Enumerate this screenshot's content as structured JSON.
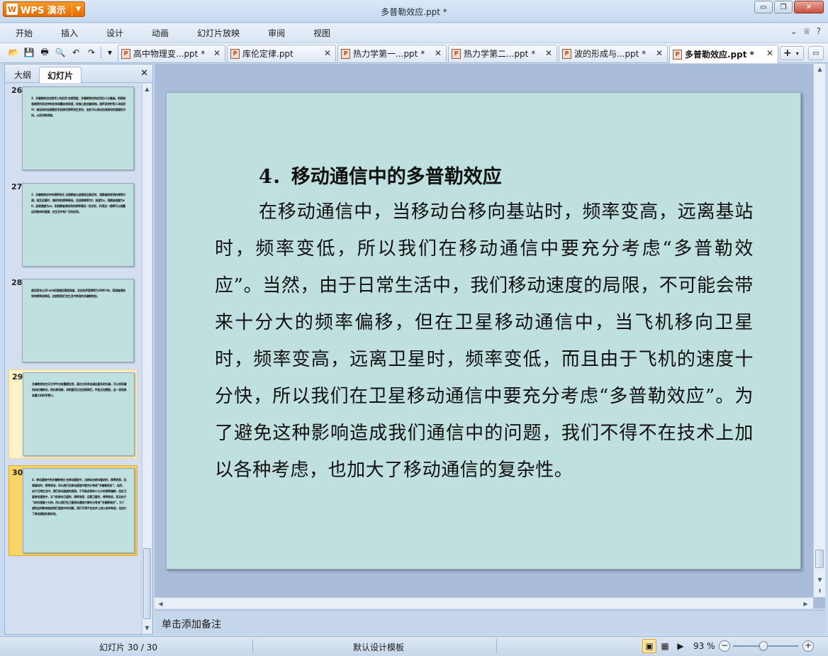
{
  "app": {
    "name": "WPS 演示",
    "logo_glyph": "W",
    "window_title": "多普勒效应.ppt *"
  },
  "window_controls": {
    "minimize": "▭",
    "restore": "❐",
    "close": "✕"
  },
  "menu": [
    "开始",
    "插入",
    "设计",
    "动画",
    "幻灯片放映",
    "审阅",
    "视图"
  ],
  "menu_right": {
    "chevron": "⌄",
    "skin": "♕",
    "help": "?"
  },
  "quick_access": {
    "open": "📂",
    "save": "💾",
    "print": "🖶",
    "preview": "🔍",
    "undo": "↶",
    "redo": "↷",
    "more": "▾"
  },
  "doc_tabs": [
    {
      "label": "高中物理变...ppt *"
    },
    {
      "label": "库伦定律.ppt"
    },
    {
      "label": "热力学第一...ppt *"
    },
    {
      "label": "热力学第二...ppt *"
    },
    {
      "label": "波的形成与...ppt *"
    },
    {
      "label": "多普勒效应.ppt *",
      "active": true
    }
  ],
  "tab_close_glyph": "✕",
  "tab_add": {
    "plus": "+",
    "dropdown": "▾"
  },
  "tab_menu_glyph": "▭",
  "ppt_icon_glyph": "P",
  "left_panel": {
    "tab_outline": "大纲",
    "tab_slides": "幻灯片",
    "close": "✕"
  },
  "thumbnails": [
    {
      "number": "26",
      "text": "3．多普勒效应在医学上的应用 在医院里，多普勒效应的应用也十分普遍。彩超检查就是利用这种效应来测量血液流速，检查心脏血管疾病。超声波发射到人体组织中，被运动的血细胞反射回来后频率发生变化，由此可以测出血液流动的速度和方向，从而诊断疾病。"
    },
    {
      "number": "27",
      "text": "2．多普勒效应中的频率变化 当观察者与波源相互靠近时，观察者接收到的频率升高；相互远离时，接收到的频率降低。设波源频率为f，波速为v，观察者速度为v0，波源速度为vs，则观察者接收到的频率满足一定关系，利用这一规律可以测量运动物体的速度，在生活中有广泛的应用。"
    },
    {
      "number": "28",
      "text": "假设某车以20 m/s的速度远离观测者，发出的声音频率为1000 Hz，观测者接收到的频率会降低，这就是我们在生活中常说的多普勒效应。"
    },
    {
      "number": "29",
      "text": "多普勒效应在天文学中也有重要应用，通过分析来自遥远星系的光谱，可以发现谱线向红端移动，即红移现象，说明星系正在远离我们。宇宙正在膨胀，这一发现具有重大的科学意义。"
    },
    {
      "number": "30",
      "text": "4．移动通信中的多普勒效应 在移动通信中，当移动台移向基站时，频率变高，远离基站时，频率变低，所以我们在移动通信中要充分考虑“多普勒效应”。当然，由于日常生活中，我们移动速度的局限，不可能会带来十分大的频率偏移，但在卫星移动通信中，当飞机移向卫星时，频率变高，远离卫星时，频率变低，而且由于飞机的速度十分快，所以我们在卫星移动通信中要充分考虑“多普勒效应”。为了避免这种影响造成我们通信中的问题，我们不得不在技术上加以各种考虑，也加大了移动通信的复杂性。"
    }
  ],
  "slide": {
    "heading": "4．移动通信中的多普勒效应",
    "body": "在移动通信中，当移动台移向基站时，频率变高，远离基站时，频率变低，所以我们在移动通信中要充分考虑“多普勒效应”。当然，由于日常生活中，我们移动速度的局限，不可能会带来十分大的频率偏移，但在卫星移动通信中，当飞机移向卫星时，频率变高，远离卫星时，频率变低，而且由于飞机的速度十分快，所以我们在卫星移动通信中要充分考虑“多普勒效应”。为了避免这种影响造成我们通信中的问题，我们不得不在技术上加以各种考虑，也加大了移动通信的复杂性。"
  },
  "scroll_glyphs": {
    "up": "▲",
    "down": "▼",
    "left": "◀",
    "right": "▶",
    "page_up": "⇞",
    "page_down": "⇟"
  },
  "notes_placeholder": "单击添加备注",
  "status": {
    "slide_indicator": "幻灯片 30 / 30",
    "template": "默认设计模板",
    "view_normal": "▣",
    "view_sorter": "▦",
    "view_show": "▶",
    "zoom": "93 %",
    "zoom_minus": "−",
    "zoom_plus": "+",
    "zoom_percent": 93
  },
  "colors": {
    "slide_bg": "#bfe0df",
    "accent": "#e36b05",
    "selected_thumb": "#f8d56b"
  }
}
